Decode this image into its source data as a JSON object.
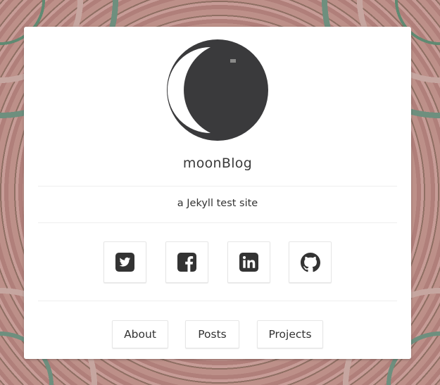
{
  "site": {
    "title": "moonBlog",
    "tagline": "a Jekyll test site"
  },
  "avatar": {
    "icon": "moon-logo-icon",
    "color": "#3a3a3c"
  },
  "social": [
    {
      "icon": "twitter-icon"
    },
    {
      "icon": "facebook-icon"
    },
    {
      "icon": "linkedin-icon"
    },
    {
      "icon": "github-icon"
    }
  ],
  "nav": [
    {
      "label": "About"
    },
    {
      "label": "Posts"
    },
    {
      "label": "Projects"
    }
  ],
  "colors": {
    "card_background": "#ffffff",
    "icon": "#333333",
    "text": "#333333"
  }
}
